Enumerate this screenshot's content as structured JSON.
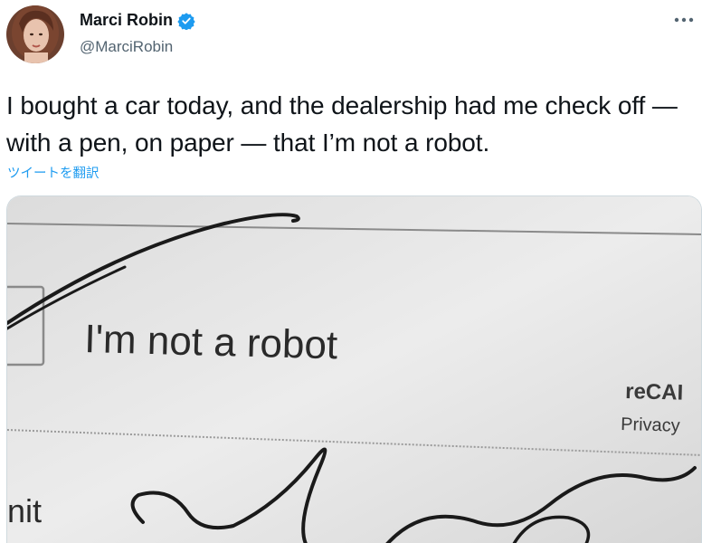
{
  "user": {
    "display_name": "Marci Robin",
    "handle": "@MarciRobin",
    "verified": true,
    "avatar_icon": "profile-photo"
  },
  "more_icon": "more-dots-icon",
  "tweet": {
    "text": "I bought a car today, and the dealership had me check off — with a pen, on paper — that I’m not a robot.",
    "translate_label": "ツイートを翻訳"
  },
  "photo": {
    "checkbox_label": "I'm not a robot",
    "brand_fragment": "reCAI",
    "privacy_fragment": "Privacy",
    "submit_fragment": "nit"
  },
  "colors": {
    "link": "#1d9bf0",
    "verified": "#1d9bf0",
    "secondary_text": "#536471",
    "primary_text": "#0f1419"
  }
}
